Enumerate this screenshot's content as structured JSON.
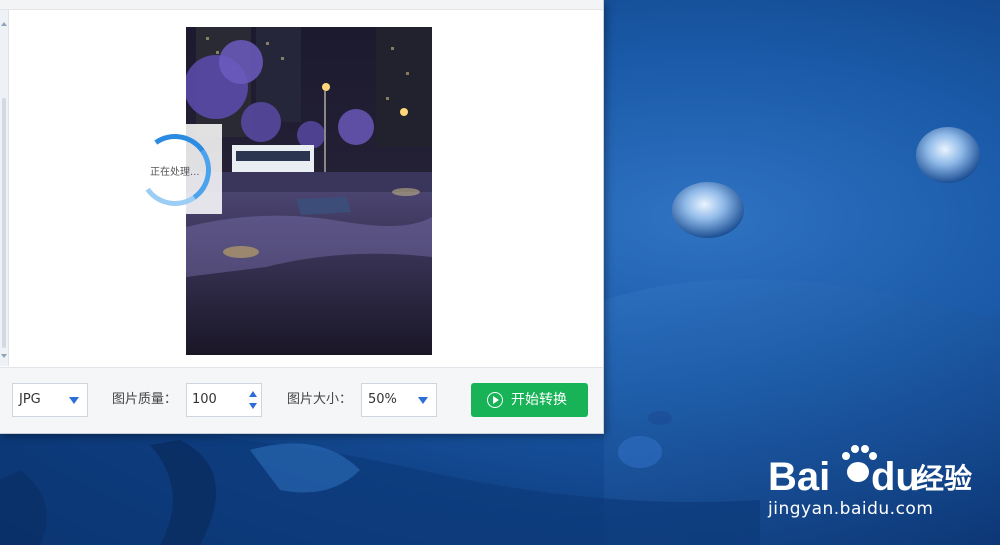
{
  "window": {
    "spinner_text": "正在处理...",
    "format_select": {
      "value": "JPG"
    },
    "quality": {
      "label": "图片质量：",
      "value": "100"
    },
    "size": {
      "label": "图片大小：",
      "value": "50%"
    },
    "start_button": {
      "label": "开始转换",
      "icon": "play-circle-icon",
      "color": "#17b356"
    }
  },
  "watermark": {
    "logo_text": "Bai",
    "logo_text_2": "du",
    "logo_cn": "经验",
    "url": "jingyan.baidu.com"
  },
  "colors": {
    "desktop": "#1a5aa8",
    "accent_blue": "#2b6fd6",
    "arrow_red": "#e8262a"
  }
}
